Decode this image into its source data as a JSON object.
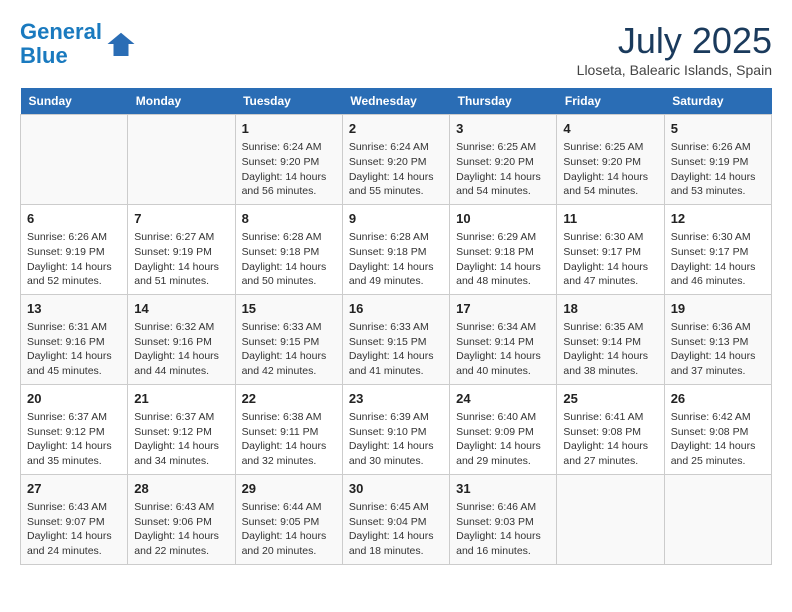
{
  "header": {
    "logo_line1": "General",
    "logo_line2": "Blue",
    "month_year": "July 2025",
    "location": "Lloseta, Balearic Islands, Spain"
  },
  "weekdays": [
    "Sunday",
    "Monday",
    "Tuesday",
    "Wednesday",
    "Thursday",
    "Friday",
    "Saturday"
  ],
  "weeks": [
    [
      {
        "day": "",
        "info": ""
      },
      {
        "day": "",
        "info": ""
      },
      {
        "day": "1",
        "info": "Sunrise: 6:24 AM\nSunset: 9:20 PM\nDaylight: 14 hours and 56 minutes."
      },
      {
        "day": "2",
        "info": "Sunrise: 6:24 AM\nSunset: 9:20 PM\nDaylight: 14 hours and 55 minutes."
      },
      {
        "day": "3",
        "info": "Sunrise: 6:25 AM\nSunset: 9:20 PM\nDaylight: 14 hours and 54 minutes."
      },
      {
        "day": "4",
        "info": "Sunrise: 6:25 AM\nSunset: 9:20 PM\nDaylight: 14 hours and 54 minutes."
      },
      {
        "day": "5",
        "info": "Sunrise: 6:26 AM\nSunset: 9:19 PM\nDaylight: 14 hours and 53 minutes."
      }
    ],
    [
      {
        "day": "6",
        "info": "Sunrise: 6:26 AM\nSunset: 9:19 PM\nDaylight: 14 hours and 52 minutes."
      },
      {
        "day": "7",
        "info": "Sunrise: 6:27 AM\nSunset: 9:19 PM\nDaylight: 14 hours and 51 minutes."
      },
      {
        "day": "8",
        "info": "Sunrise: 6:28 AM\nSunset: 9:18 PM\nDaylight: 14 hours and 50 minutes."
      },
      {
        "day": "9",
        "info": "Sunrise: 6:28 AM\nSunset: 9:18 PM\nDaylight: 14 hours and 49 minutes."
      },
      {
        "day": "10",
        "info": "Sunrise: 6:29 AM\nSunset: 9:18 PM\nDaylight: 14 hours and 48 minutes."
      },
      {
        "day": "11",
        "info": "Sunrise: 6:30 AM\nSunset: 9:17 PM\nDaylight: 14 hours and 47 minutes."
      },
      {
        "day": "12",
        "info": "Sunrise: 6:30 AM\nSunset: 9:17 PM\nDaylight: 14 hours and 46 minutes."
      }
    ],
    [
      {
        "day": "13",
        "info": "Sunrise: 6:31 AM\nSunset: 9:16 PM\nDaylight: 14 hours and 45 minutes."
      },
      {
        "day": "14",
        "info": "Sunrise: 6:32 AM\nSunset: 9:16 PM\nDaylight: 14 hours and 44 minutes."
      },
      {
        "day": "15",
        "info": "Sunrise: 6:33 AM\nSunset: 9:15 PM\nDaylight: 14 hours and 42 minutes."
      },
      {
        "day": "16",
        "info": "Sunrise: 6:33 AM\nSunset: 9:15 PM\nDaylight: 14 hours and 41 minutes."
      },
      {
        "day": "17",
        "info": "Sunrise: 6:34 AM\nSunset: 9:14 PM\nDaylight: 14 hours and 40 minutes."
      },
      {
        "day": "18",
        "info": "Sunrise: 6:35 AM\nSunset: 9:14 PM\nDaylight: 14 hours and 38 minutes."
      },
      {
        "day": "19",
        "info": "Sunrise: 6:36 AM\nSunset: 9:13 PM\nDaylight: 14 hours and 37 minutes."
      }
    ],
    [
      {
        "day": "20",
        "info": "Sunrise: 6:37 AM\nSunset: 9:12 PM\nDaylight: 14 hours and 35 minutes."
      },
      {
        "day": "21",
        "info": "Sunrise: 6:37 AM\nSunset: 9:12 PM\nDaylight: 14 hours and 34 minutes."
      },
      {
        "day": "22",
        "info": "Sunrise: 6:38 AM\nSunset: 9:11 PM\nDaylight: 14 hours and 32 minutes."
      },
      {
        "day": "23",
        "info": "Sunrise: 6:39 AM\nSunset: 9:10 PM\nDaylight: 14 hours and 30 minutes."
      },
      {
        "day": "24",
        "info": "Sunrise: 6:40 AM\nSunset: 9:09 PM\nDaylight: 14 hours and 29 minutes."
      },
      {
        "day": "25",
        "info": "Sunrise: 6:41 AM\nSunset: 9:08 PM\nDaylight: 14 hours and 27 minutes."
      },
      {
        "day": "26",
        "info": "Sunrise: 6:42 AM\nSunset: 9:08 PM\nDaylight: 14 hours and 25 minutes."
      }
    ],
    [
      {
        "day": "27",
        "info": "Sunrise: 6:43 AM\nSunset: 9:07 PM\nDaylight: 14 hours and 24 minutes."
      },
      {
        "day": "28",
        "info": "Sunrise: 6:43 AM\nSunset: 9:06 PM\nDaylight: 14 hours and 22 minutes."
      },
      {
        "day": "29",
        "info": "Sunrise: 6:44 AM\nSunset: 9:05 PM\nDaylight: 14 hours and 20 minutes."
      },
      {
        "day": "30",
        "info": "Sunrise: 6:45 AM\nSunset: 9:04 PM\nDaylight: 14 hours and 18 minutes."
      },
      {
        "day": "31",
        "info": "Sunrise: 6:46 AM\nSunset: 9:03 PM\nDaylight: 14 hours and 16 minutes."
      },
      {
        "day": "",
        "info": ""
      },
      {
        "day": "",
        "info": ""
      }
    ]
  ]
}
